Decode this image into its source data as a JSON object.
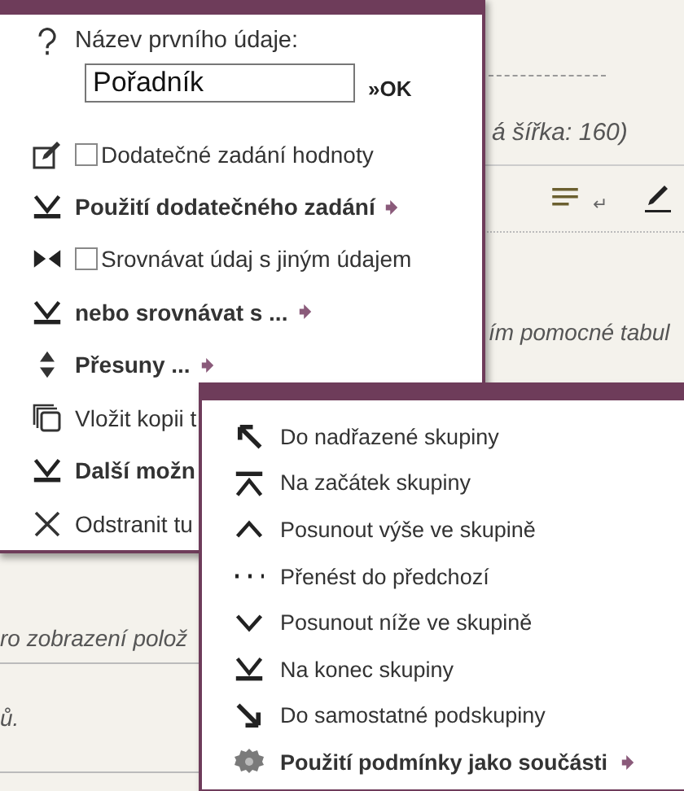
{
  "background": {
    "texts": [
      {
        "kind": "hint",
        "text": "á šířka: 160)"
      },
      {
        "kind": "hint",
        "text": "ím pomocné tabul"
      },
      {
        "kind": "hint",
        "text": "ro zobrazení polož"
      },
      {
        "kind": "hint",
        "text": "ů."
      }
    ],
    "toolbar": {
      "return_symbol": "↵"
    }
  },
  "menu": {
    "field": {
      "label": "Název prvního údaje:",
      "value": "Pořadník",
      "button": "»OK"
    },
    "items": [
      {
        "kind": "checkbox",
        "label": "Dodatečné zadání hodnoty",
        "checked": false
      },
      {
        "kind": "submenu",
        "label": "Použití dodatečného zadání"
      },
      {
        "kind": "checkbox",
        "label": "Srovnávat údaj s jiným údajem",
        "checked": false
      },
      {
        "kind": "submenu",
        "label": "nebo srovnávat s ..."
      },
      {
        "kind": "submenu",
        "label": "Přesuny ..."
      },
      {
        "kind": "action",
        "label": "Vložit kopii t"
      },
      {
        "kind": "bold",
        "label": "Další možn"
      },
      {
        "kind": "action",
        "label": "Odstranit tu"
      }
    ]
  },
  "submenu": {
    "items": [
      {
        "kind": "action",
        "label": "Do nadřazené skupiny"
      },
      {
        "kind": "action",
        "label": "Na začátek skupiny"
      },
      {
        "kind": "action",
        "label": "Posunout výše ve skupině"
      },
      {
        "kind": "action",
        "label": "Přenést do předchozí"
      },
      {
        "kind": "action",
        "label": "Posunout níže ve skupině"
      },
      {
        "kind": "action",
        "label": "Na konec skupiny"
      },
      {
        "kind": "action",
        "label": "Do samostatné podskupiny"
      },
      {
        "kind": "submenu",
        "label": "Použití podmínky jako součásti"
      }
    ]
  }
}
